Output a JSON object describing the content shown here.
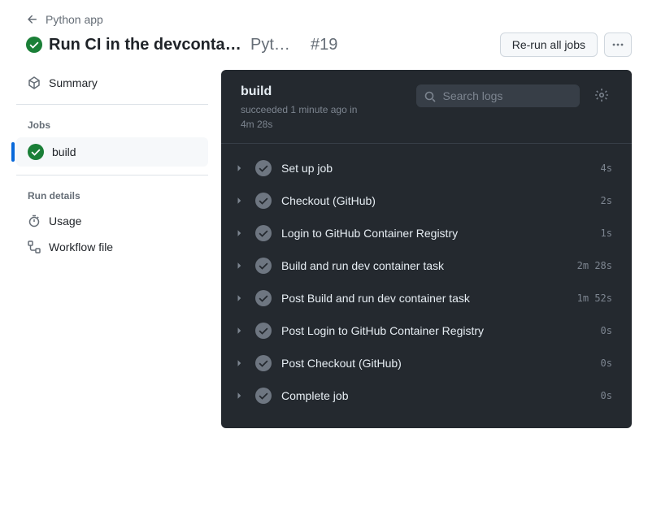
{
  "breadcrumb": {
    "label": "Python app"
  },
  "title": {
    "main": "Run CI in the devcontainer",
    "sub": "Python app",
    "number": "#19"
  },
  "buttons": {
    "rerun": "Re-run all jobs"
  },
  "sidebar": {
    "summary": "Summary",
    "jobs_header": "Jobs",
    "jobs": [
      {
        "label": "build"
      }
    ],
    "run_details_header": "Run details",
    "usage": "Usage",
    "workflow_file": "Workflow file"
  },
  "content": {
    "job_name": "build",
    "status_text": "succeeded 1 minute ago in 4m 28s",
    "search_placeholder": "Search logs"
  },
  "steps": [
    {
      "name": "Set up job",
      "duration": "4s"
    },
    {
      "name": "Checkout (GitHub)",
      "duration": "2s"
    },
    {
      "name": "Login to GitHub Container Registry",
      "duration": "1s"
    },
    {
      "name": "Build and run dev container task",
      "duration": "2m 28s"
    },
    {
      "name": "Post Build and run dev container task",
      "duration": "1m 52s"
    },
    {
      "name": "Post Login to GitHub Container Registry",
      "duration": "0s"
    },
    {
      "name": "Post Checkout (GitHub)",
      "duration": "0s"
    },
    {
      "name": "Complete job",
      "duration": "0s"
    }
  ]
}
